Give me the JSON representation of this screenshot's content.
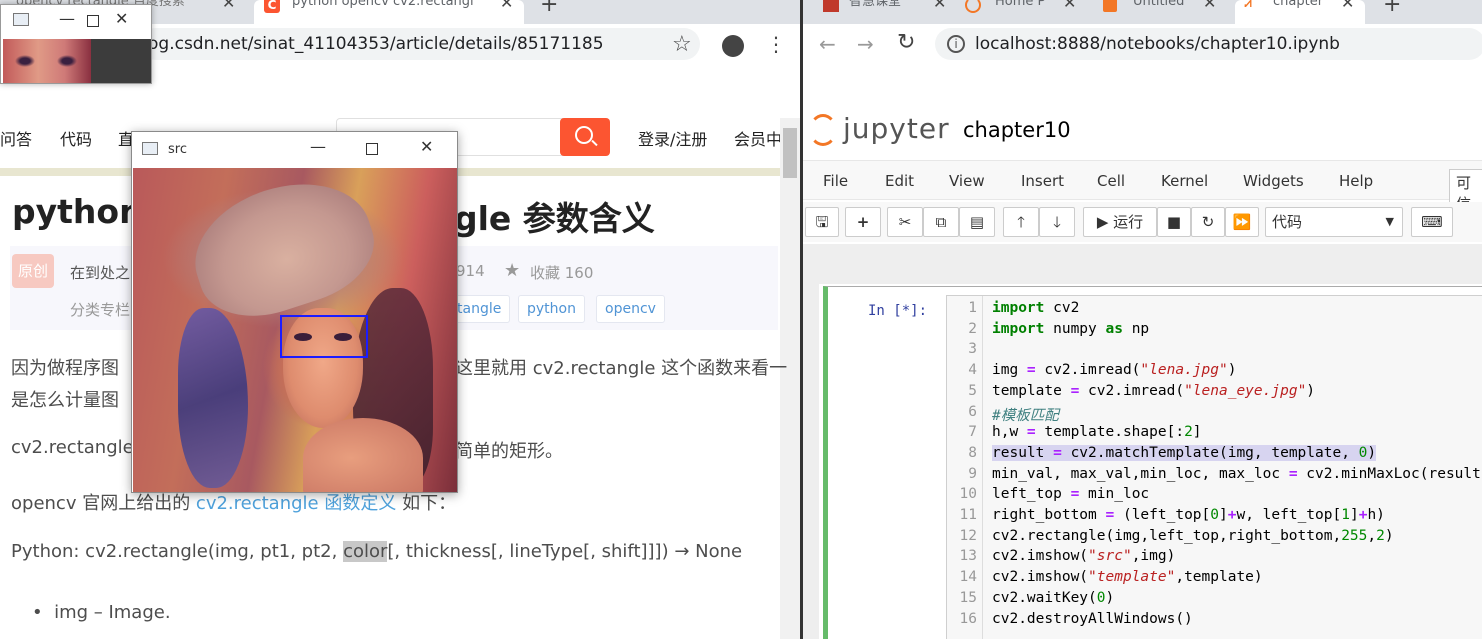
{
  "left_browser": {
    "tabs": [
      {
        "title": "opencv rectangle 百度搜索"
      },
      {
        "title": "python opencv cv2.rectangl"
      }
    ],
    "url": "og.csdn.net/sinat_41104353/article/details/85171185",
    "nav": [
      "问答",
      "代码",
      "直",
      "登录/注册",
      "会员中"
    ],
    "article_title_left": "python",
    "article_title_right": "gle 参数含义",
    "badge": "原创",
    "author_text": "在到处之",
    "views_fragment": "914",
    "collect": "收藏 160",
    "category": "分类专栏",
    "tags": [
      "tangle",
      "python",
      "opencv"
    ],
    "para1_left": "因为做程序图",
    "para1_right": "这里就用 cv2.rectangle 这个函数来看一",
    "para1_line2": "是怎么计量图",
    "para2_left": "cv2.rectangle",
    "para2_right": "简单的矩形。",
    "para3_a": "opencv 官网上给出的 ",
    "para3_link": "cv2.rectangle 函数定义",
    "para3_b": " 如下：",
    "para4_a": "Python: cv2.rectangle(img, pt1, pt2, ",
    "para4_hl": "color",
    "para4_b": "[, thickness[, lineType[, shift]]]) → None",
    "bullet1": "img – Image."
  },
  "src_window": {
    "title": "src"
  },
  "right_browser": {
    "tabs": [
      {
        "title": "智慧课堂"
      },
      {
        "title": "Home P"
      },
      {
        "title": "Untitled"
      },
      {
        "title": "chapter"
      }
    ],
    "url": "localhost:8888/notebooks/chapter10.ipynb",
    "logo": "jupyter",
    "notebook_name": "chapter10",
    "menu": [
      "File",
      "Edit",
      "View",
      "Insert",
      "Cell",
      "Kernel",
      "Widgets",
      "Help"
    ],
    "trusted": "可信",
    "run_label": "运行",
    "cell_type": "代码",
    "prompt": "In  [*]:",
    "line_numbers": [
      "1",
      "2",
      "3",
      "4",
      "5",
      "6",
      "7",
      "8",
      "9",
      "10",
      "11",
      "12",
      "13",
      "14",
      "15",
      "16"
    ]
  }
}
